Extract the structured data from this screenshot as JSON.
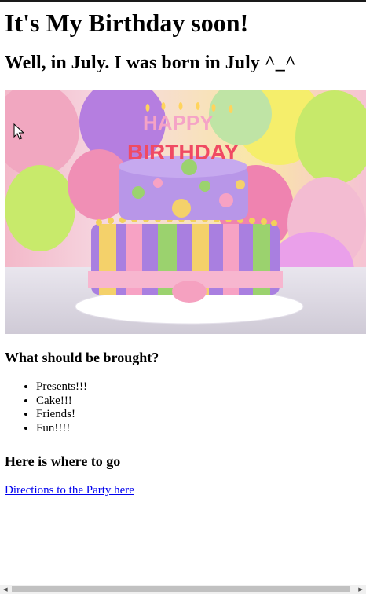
{
  "page": {
    "title": "It's My Birthday soon!",
    "subtitle": "Well, in July. I was born in July ^_^",
    "hero_image": {
      "cake_sign_top": "HAPPY",
      "cake_sign_bottom": "BIRTHDAY"
    },
    "bring_heading": "What should be brought?",
    "bring_items": [
      "Presents!!!",
      "Cake!!!",
      "Friends!",
      "Fun!!!!"
    ],
    "where_heading": "Here is where to go",
    "directions_link": "Directions to the Party here"
  },
  "browser": {
    "horizontal_scrollbar": {
      "left_arrow_icon": "triangle-left-icon",
      "right_arrow_icon": "triangle-right-icon"
    },
    "cursor_icon": "mouse-pointer-icon"
  },
  "colors": {
    "link": "#0000ee",
    "text": "#000000",
    "background": "#ffffff"
  }
}
